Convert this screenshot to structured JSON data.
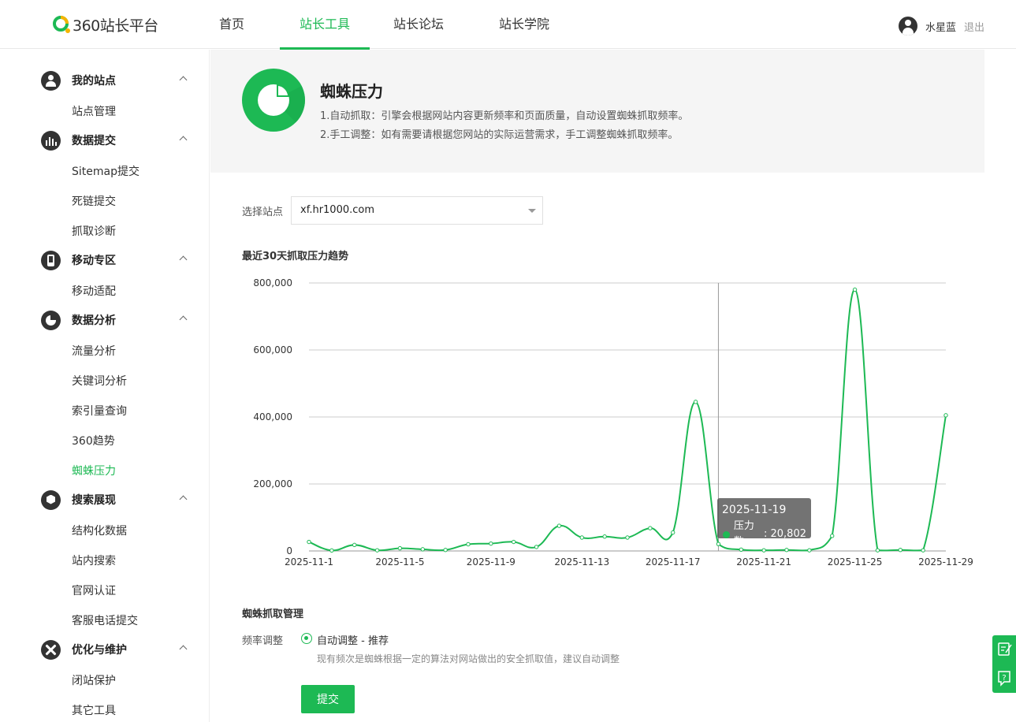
{
  "header": {
    "logo_text": "360站长平台",
    "nav": [
      {
        "label": "首页"
      },
      {
        "label": "站长工具"
      },
      {
        "label": "站长论坛"
      },
      {
        "label": "站长学院"
      }
    ],
    "user_name": "水星蓝",
    "logout": "退出"
  },
  "sidebar": {
    "sections": [
      {
        "title": "我的站点",
        "icon": "user-icon",
        "items": [
          "站点管理"
        ]
      },
      {
        "title": "数据提交",
        "icon": "bar-chart-icon",
        "items": [
          "Sitemap提交",
          "死链提交",
          "抓取诊断"
        ]
      },
      {
        "title": "移动专区",
        "icon": "mobile-icon",
        "items": [
          "移动适配"
        ]
      },
      {
        "title": "数据分析",
        "icon": "pie-chart-icon",
        "items": [
          "流量分析",
          "关键词分析",
          "索引量查询",
          "360趋势",
          "蜘蛛压力"
        ]
      },
      {
        "title": "搜索展现",
        "icon": "cube-icon",
        "items": [
          "结构化数据",
          "站内搜索",
          "官网认证",
          "客服电话提交"
        ]
      },
      {
        "title": "优化与维护",
        "icon": "tools-icon",
        "items": [
          "闭站保护",
          "其它工具"
        ]
      }
    ],
    "active_item": "蜘蛛压力"
  },
  "banner": {
    "title": "蜘蛛压力",
    "line1": "1.自动抓取：引擎会根据网站内容更新频率和页面质量，自动设置蜘蛛抓取频率。",
    "line2": "2.手工调整：如有需要请根据您网站的实际运营需求，手工调整蜘蛛抓取频率。"
  },
  "site_select": {
    "label": "选择站点",
    "value": "xf.hr1000.com"
  },
  "chart_title": "最近30天抓取压力趋势",
  "chart_data": {
    "type": "line",
    "x": [
      "2025-11-1",
      "2025-11-2",
      "2025-11-3",
      "2025-11-4",
      "2025-11-5",
      "2025-11-6",
      "2025-11-7",
      "2025-11-8",
      "2025-11-9",
      "2025-11-10",
      "2025-11-11",
      "2025-11-12",
      "2025-11-13",
      "2025-11-14",
      "2025-11-15",
      "2025-11-16",
      "2025-11-17",
      "2025-11-18",
      "2025-11-19",
      "2025-11-20",
      "2025-11-21",
      "2025-11-22",
      "2025-11-23",
      "2025-11-24",
      "2025-11-25",
      "2025-11-26",
      "2025-11-27",
      "2025-11-28",
      "2025-11-29"
    ],
    "x_tick_labels": [
      "2025-11-1",
      "2025-11-5",
      "2025-11-9",
      "2025-11-13",
      "2025-11-17",
      "2025-11-21",
      "2025-11-25",
      "2025-11-29"
    ],
    "series": [
      {
        "name": "压力数",
        "color": "#1db954",
        "values": [
          27000,
          1500,
          18000,
          2000,
          8000,
          5000,
          3000,
          20000,
          22000,
          27000,
          12000,
          75000,
          40000,
          43000,
          40000,
          68000,
          55000,
          445000,
          20802,
          4000,
          2000,
          3000,
          2000,
          45000,
          780000,
          2000,
          3000,
          2000,
          405000
        ]
      }
    ],
    "ylim": [
      0,
      800000
    ],
    "y_ticks": [
      "0",
      "200,000",
      "400,000",
      "600,000",
      "800,000"
    ],
    "grid": true,
    "tooltip": {
      "date": "2025-11-19",
      "label": "压力数",
      "value": "20,802"
    }
  },
  "management": {
    "title": "蜘蛛抓取管理",
    "freq_label": "频率调整",
    "option_label": "自动调整 - 推荐",
    "hint": "现有频次是蜘蛛根据一定的算法对网站做出的安全抓取值，建议自动调整",
    "submit": "提交"
  },
  "float_bar": {
    "icons": [
      "feedback-icon",
      "help-icon"
    ]
  },
  "colors": {
    "accent": "#1db954"
  }
}
